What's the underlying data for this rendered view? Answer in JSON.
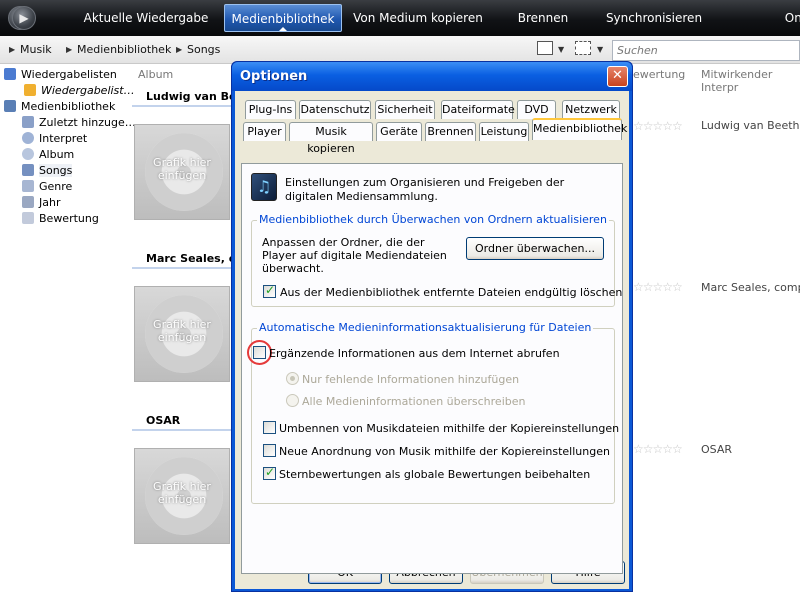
{
  "topbar": {
    "tabs": [
      "Aktuelle Wiedergabe",
      "Medienbibliothek",
      "Von Medium kopieren",
      "Brennen",
      "Synchronisieren",
      "Onl"
    ],
    "active_tab": "Medienbibliothek"
  },
  "breadcrumb": {
    "items": [
      "Musik",
      "Medienbibliothek",
      "Songs"
    ],
    "search_placeholder": "Suchen"
  },
  "nav": {
    "items": [
      {
        "label": "Wiedergabelisten"
      },
      {
        "label": "Wiedergabelist…"
      },
      {
        "label": "Medienbibliothek"
      },
      {
        "label": "Zuletzt hinzuge…"
      },
      {
        "label": "Interpret"
      },
      {
        "label": "Album"
      },
      {
        "label": "Songs"
      },
      {
        "label": "Genre"
      },
      {
        "label": "Jahr"
      },
      {
        "label": "Bewertung"
      }
    ]
  },
  "list": {
    "headers": {
      "album": "Album",
      "rating": "ewertung",
      "contributing": "Mitwirkender Interpr"
    },
    "groups": [
      {
        "title": "Ludwig van Bee",
        "art": "Grafik hier einfügen",
        "stars": "☆☆☆☆☆",
        "artist": "Ludwig van Beethove"
      },
      {
        "title": "Marc Seales, co",
        "art": "Grafik hier einfügen",
        "stars": "☆☆☆☆☆",
        "artist": "Marc Seales, compos"
      },
      {
        "title": "OSAR",
        "art": "Grafik hier einfügen",
        "stars": "☆☆☆☆☆",
        "artist": "OSAR"
      }
    ]
  },
  "dialog": {
    "title": "Optionen",
    "close": "✕",
    "tabs_row1": [
      "Plug-Ins",
      "Datenschutz",
      "Sicherheit",
      "Dateiformate",
      "DVD",
      "Netzwerk"
    ],
    "tabs_row2": [
      "Player",
      "Musik kopieren",
      "Geräte",
      "Brennen",
      "Leistung",
      "Medienbibliothek"
    ],
    "active_tab": "Medienbibliothek",
    "intro": "Einstellungen zum Organisieren und Freigeben der digitalen Mediensammlung.",
    "group1": {
      "legend": "Medienbibliothek durch Überwachen von Ordnern aktualisieren",
      "description": "Anpassen der Ordner, die der Player auf digitale Mediendateien überwacht.",
      "button": "Ordner überwachen...",
      "checkbox_delete": {
        "label": "Aus der Medienbibliothek entfernte Dateien endgültig löschen",
        "checked": true
      }
    },
    "group2": {
      "legend": "Automatische Medieninformationsaktualisierung für Dateien",
      "checkbox_internet": {
        "label": "Ergänzende Informationen aus dem Internet abrufen",
        "checked": false
      },
      "radio_missing": {
        "label": "Nur fehlende Informationen hinzufügen",
        "selected": true
      },
      "radio_overwrite": {
        "label": "Alle Medieninformationen überschreiben",
        "selected": false
      },
      "checkbox_rename": {
        "label": "Umbennen von Musikdateien mithilfe der Kopiereinstellungen",
        "checked": false
      },
      "checkbox_reorder": {
        "label": "Neue Anordnung von Musik mithilfe der Kopiereinstellungen",
        "checked": false
      },
      "checkbox_stars": {
        "label": "Sternbewertungen als globale Bewertungen beibehalten",
        "checked": true
      }
    },
    "buttons": {
      "ok": "OK",
      "cancel": "Abbrechen",
      "apply": "Übernehmen",
      "help": "Hilfe"
    }
  },
  "colors": {
    "accent": "#0b58d6",
    "highlight_ring": "#e53a3a",
    "legend": "#0046d5"
  }
}
